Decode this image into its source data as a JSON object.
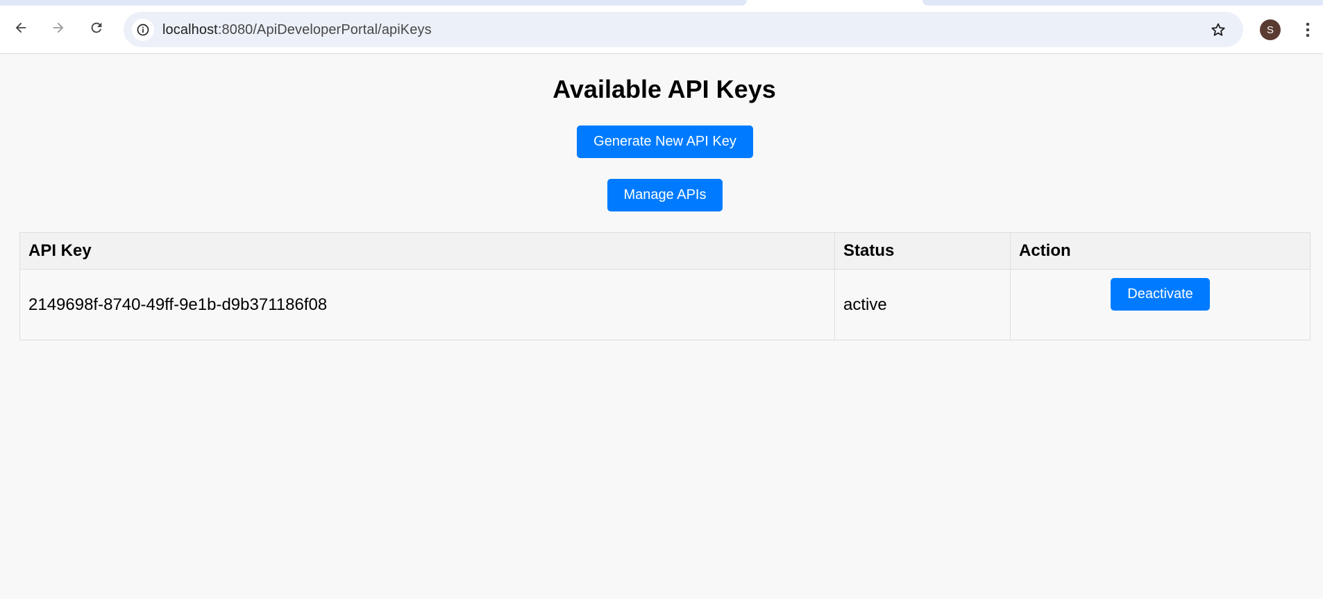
{
  "browser": {
    "url_host": "localhost",
    "url_rest": ":8080/ApiDeveloperPortal/apiKeys",
    "profile_initial": "S",
    "colors": {
      "omnibox": "#ecf0f9",
      "avatar": "#5a3b32"
    },
    "icons": [
      "back-arrow-icon",
      "forward-arrow-icon",
      "reload-icon",
      "site-info-icon",
      "bookmark-star-icon",
      "more-vert-icon"
    ]
  },
  "page": {
    "title": "Available API Keys",
    "generate_button": "Generate New API Key",
    "manage_button": "Manage APIs",
    "accent_color": "#007bff"
  },
  "table": {
    "headers": {
      "key": "API Key",
      "status": "Status",
      "action": "Action"
    },
    "rows": [
      {
        "key": "2149698f-8740-49ff-9e1b-d9b371186f08",
        "status": "active",
        "action_label": "Deactivate"
      }
    ]
  }
}
